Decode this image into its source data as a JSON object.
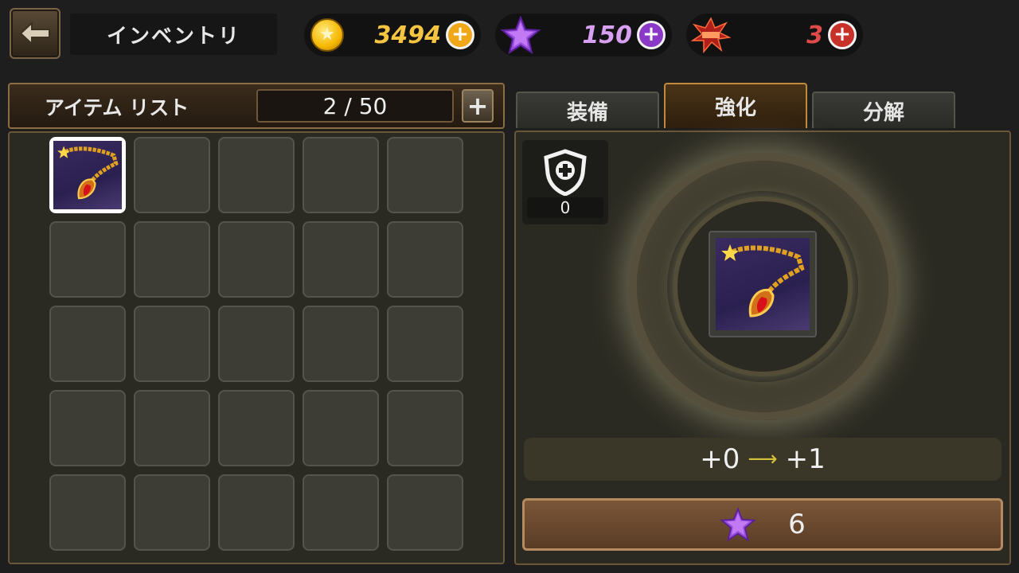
{
  "header": {
    "title": "インベントリ",
    "currencies": {
      "gold": {
        "value": "3494",
        "color": "#f5c542",
        "icon": "gold-coin-icon"
      },
      "stars": {
        "value": "150",
        "color": "#d8a0f0",
        "icon": "purple-star-icon"
      },
      "boom": {
        "value": "3",
        "color": "#e04a4a",
        "icon": "boom-icon"
      }
    }
  },
  "inventory": {
    "title": "アイテム リスト",
    "count": "2 / 50",
    "add_label": "+",
    "slots_filled": 1,
    "slots_visible": 25
  },
  "tabs": [
    {
      "label": "装備",
      "active": false
    },
    {
      "label": "強化",
      "active": true
    },
    {
      "label": "分解",
      "active": false
    }
  ],
  "enhance": {
    "protect_count": "0",
    "level_from": "+0",
    "level_to": "+1",
    "cost": "6",
    "cost_icon": "purple-star-icon"
  }
}
